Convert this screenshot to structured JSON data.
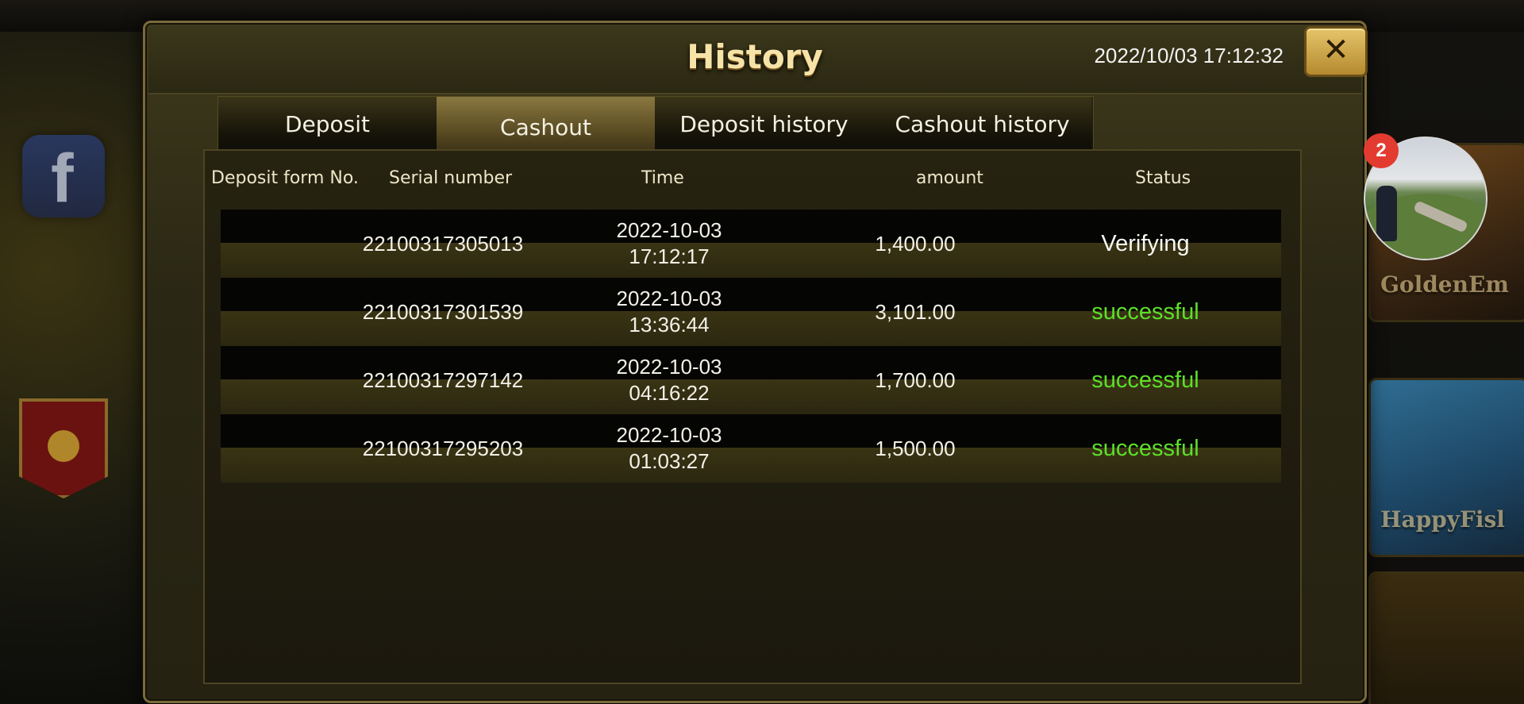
{
  "dialog": {
    "title": "History",
    "datetime": "2022/10/03 17:12:32",
    "close_label": "✕"
  },
  "tabs": [
    {
      "label": "Deposit",
      "active": false
    },
    {
      "label": "Cashout",
      "active": true
    },
    {
      "label": "Deposit history",
      "active": false
    },
    {
      "label": "Cashout history",
      "active": false
    }
  ],
  "table": {
    "columns": [
      "Deposit form No.",
      "Serial number",
      "Time",
      "amount",
      "Status"
    ],
    "rows": [
      {
        "serial": "22100317305013",
        "date": "2022-10-03",
        "time": "17:12:17",
        "amount": "1,400.00",
        "status": "Verifying"
      },
      {
        "serial": "22100317301539",
        "date": "2022-10-03",
        "time": "13:36:44",
        "amount": "3,101.00",
        "status": "successful"
      },
      {
        "serial": "22100317297142",
        "date": "2022-10-03",
        "time": "04:16:22",
        "amount": "1,700.00",
        "status": "successful"
      },
      {
        "serial": "22100317295203",
        "date": "2022-10-03",
        "time": "01:03:27",
        "amount": "1,500.00",
        "status": "successful"
      }
    ]
  },
  "background": {
    "facebook_tile_glyph": "f",
    "game_tiles": [
      "GoldenEm",
      "HappyFisl"
    ]
  },
  "avatar": {
    "notification_count": "2"
  },
  "colors": {
    "status_success": "#5ce02a",
    "status_pending": "#f7f7f2",
    "title_gold": "#f6e3a8",
    "close_button": "#d4ac4e"
  }
}
